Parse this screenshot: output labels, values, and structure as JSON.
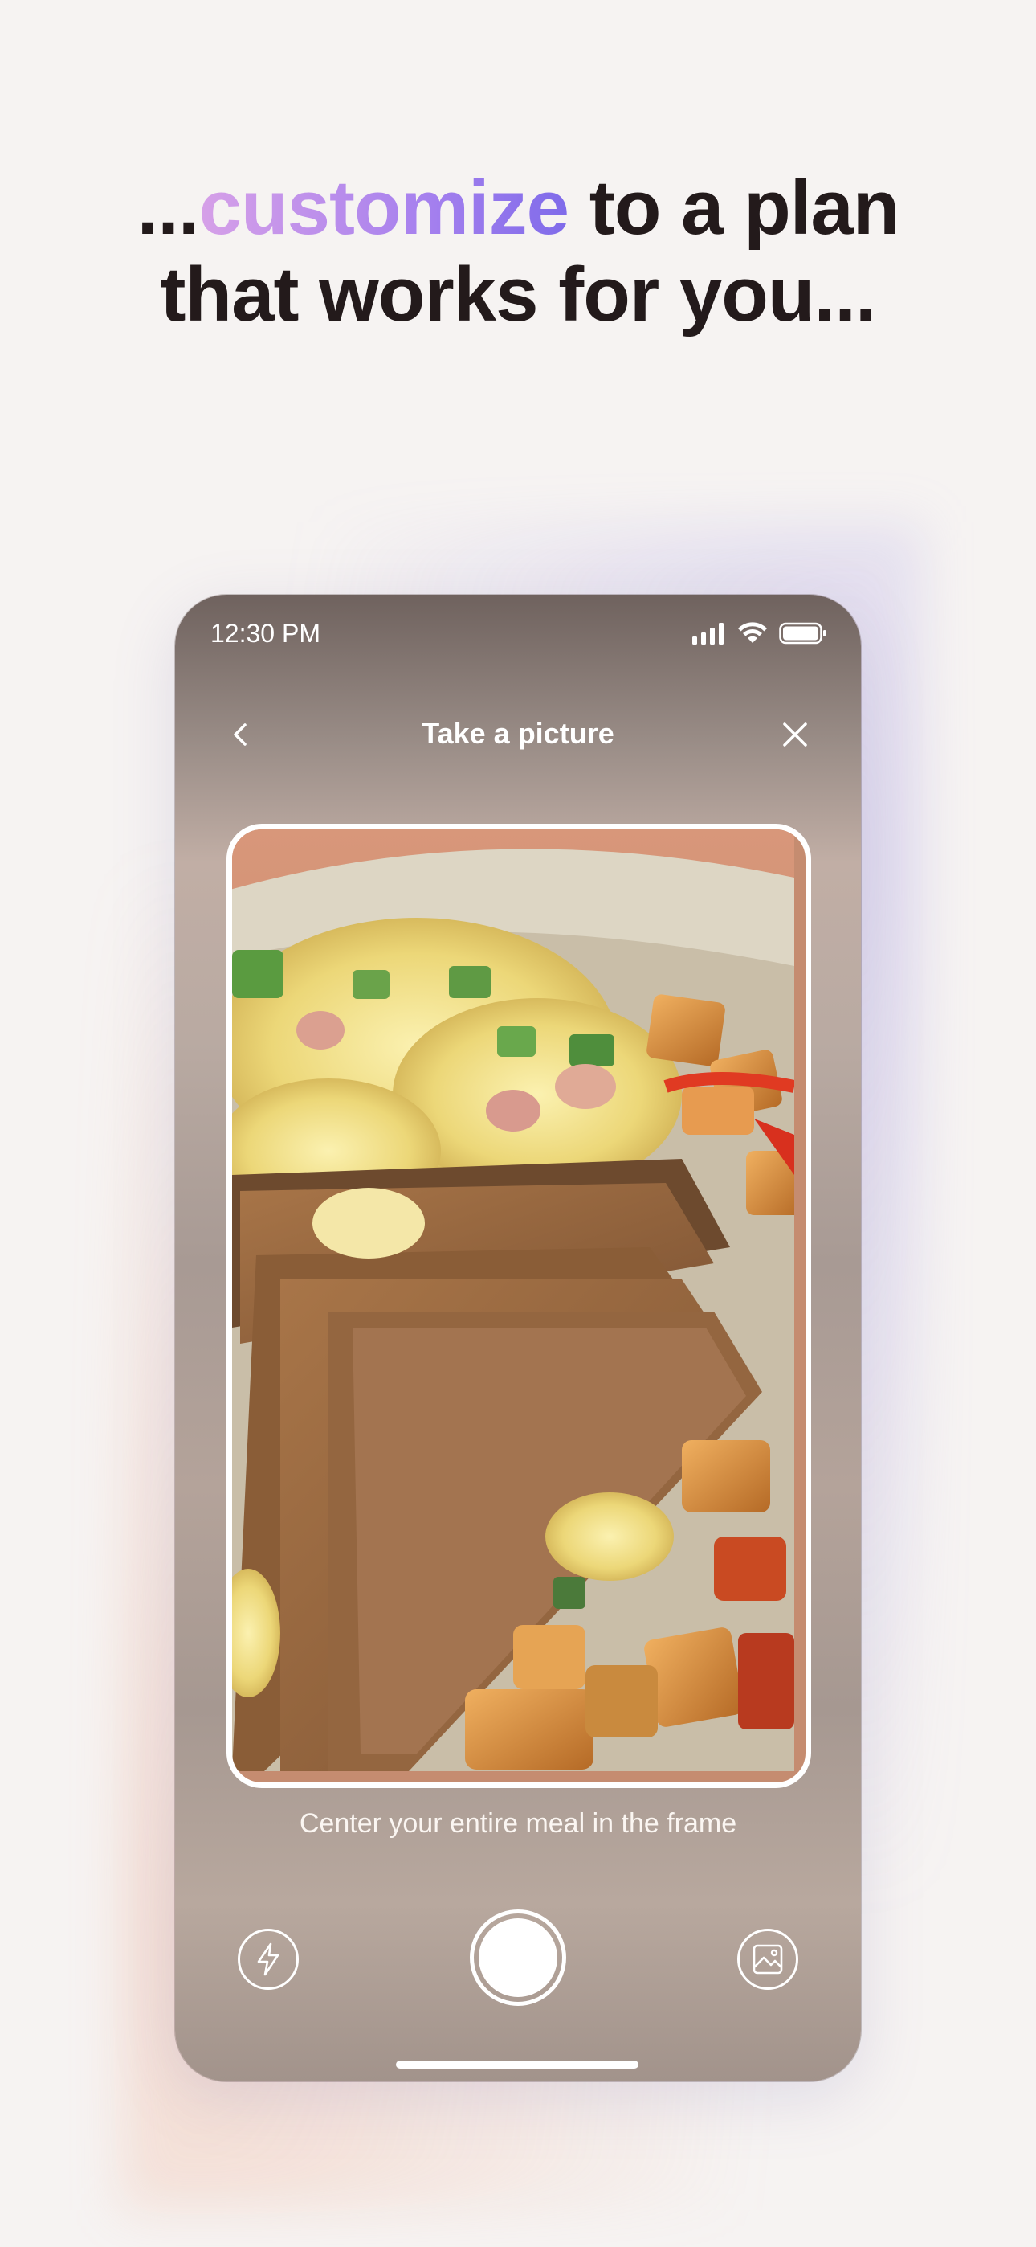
{
  "headline": {
    "prefix": "...",
    "accent": "customize",
    "line1_rest": " to a plan",
    "line2": "that works for you..."
  },
  "status_bar": {
    "time": "12:30 PM",
    "icons": [
      "signal-icon",
      "wifi-icon",
      "battery-icon"
    ]
  },
  "nav": {
    "title": "Take a picture",
    "back_icon": "chevron-left-icon",
    "close_icon": "close-icon"
  },
  "camera": {
    "hint": "Center your entire meal in the frame",
    "flash_icon": "flash-icon",
    "gallery_icon": "gallery-icon",
    "shutter_icon": "shutter-button"
  },
  "colors": {
    "accent_start": "#d6a0e8",
    "accent_end": "#7f6bea",
    "headline": "#231a1b",
    "background": "#f6f3f2"
  }
}
